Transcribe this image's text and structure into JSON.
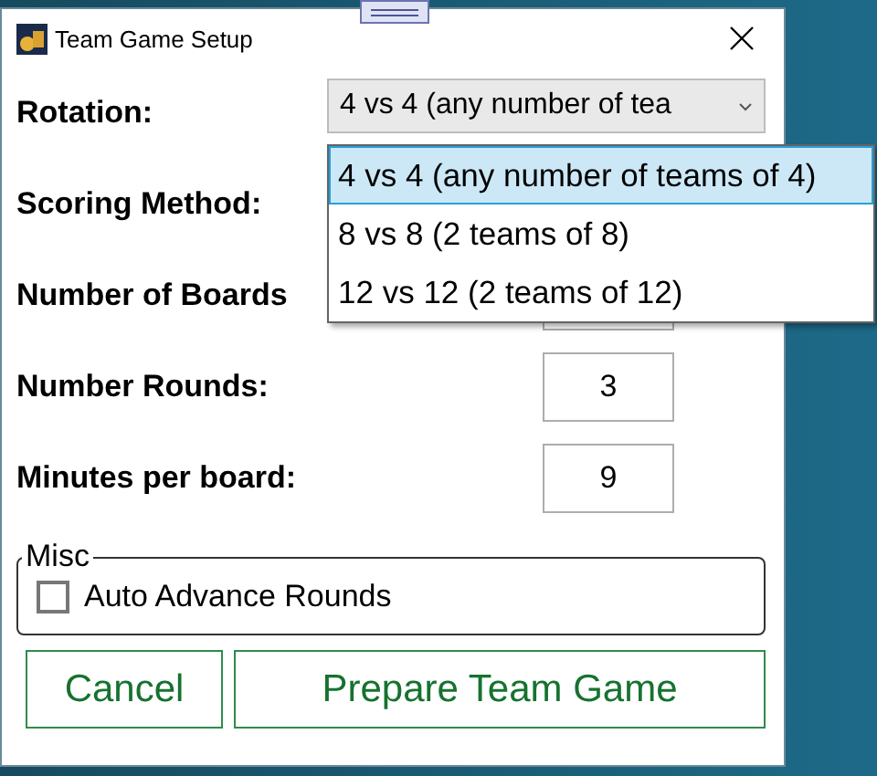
{
  "window": {
    "title": "Team Game Setup"
  },
  "fields": [
    {
      "kind": "combo",
      "label": "Rotation:",
      "value": "4 vs 4 (any number of tea",
      "expanded": true,
      "options": [
        {
          "label": "4 vs 4 (any number of teams of 4)",
          "selected": true
        },
        {
          "label": "8 vs 8 (2 teams of 8)",
          "selected": false
        },
        {
          "label": "12 vs 12 (2 teams of 12)",
          "selected": false
        }
      ]
    },
    {
      "kind": "hidden",
      "label": "Scoring Method:"
    },
    {
      "kind": "number",
      "label": "Number of Boards"
    },
    {
      "kind": "number",
      "label": "Number Rounds:",
      "value": "3"
    },
    {
      "kind": "number",
      "label": "Minutes per board:",
      "value": "9"
    }
  ],
  "misc": {
    "title": "Misc",
    "checkbox": {
      "label": "Auto Advance Rounds",
      "checked": false
    }
  },
  "buttons": [
    "Cancel",
    "Prepare Team Game"
  ]
}
